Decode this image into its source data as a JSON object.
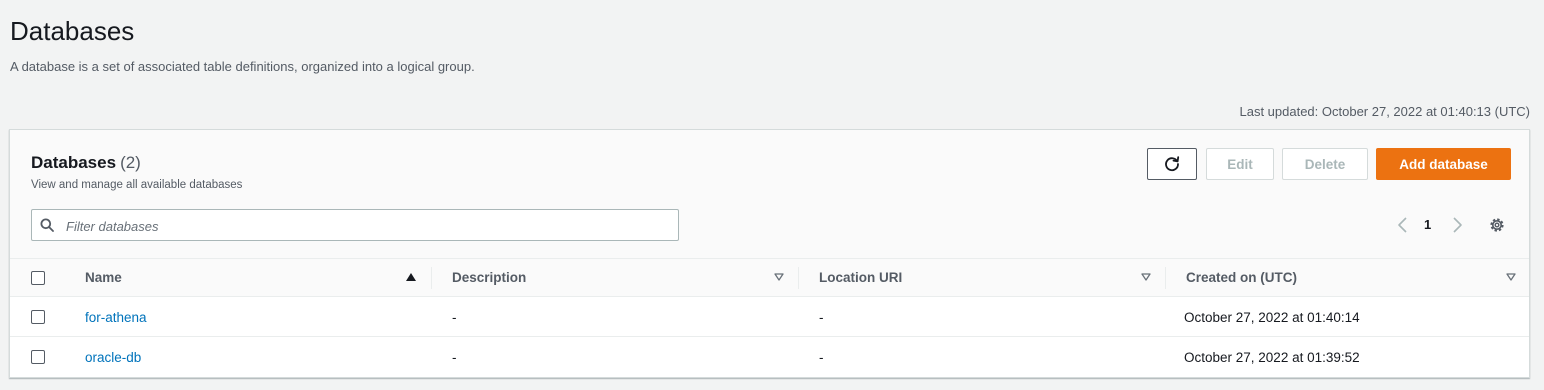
{
  "page": {
    "title": "Databases",
    "description": "A database is a set of associated table definitions, organized into a logical group.",
    "last_updated": "Last updated: October 27, 2022 at 01:40:13 (UTC)"
  },
  "panel": {
    "title": "Databases",
    "count": "(2)",
    "subtitle": "View and manage all available databases",
    "buttons": {
      "edit": "Edit",
      "delete": "Delete",
      "add": "Add database"
    },
    "filter_placeholder": "Filter databases",
    "current_page": "1"
  },
  "table": {
    "columns": [
      "Name",
      "Description",
      "Location URI",
      "Created on (UTC)"
    ],
    "rows": [
      {
        "name": "for-athena",
        "description": "-",
        "location": "-",
        "created": "October 27, 2022 at 01:40:14"
      },
      {
        "name": "oracle-db",
        "description": "-",
        "location": "-",
        "created": "October 27, 2022 at 01:39:52"
      }
    ]
  },
  "colors": {
    "accent": "#ec7211",
    "link": "#0073bb",
    "background": "#f2f3f3"
  },
  "icons": [
    "refresh-icon",
    "search-icon",
    "chevron-left-icon",
    "chevron-right-icon",
    "settings-gear-icon",
    "sort-ascending-icon",
    "sort-descending-icon"
  ]
}
